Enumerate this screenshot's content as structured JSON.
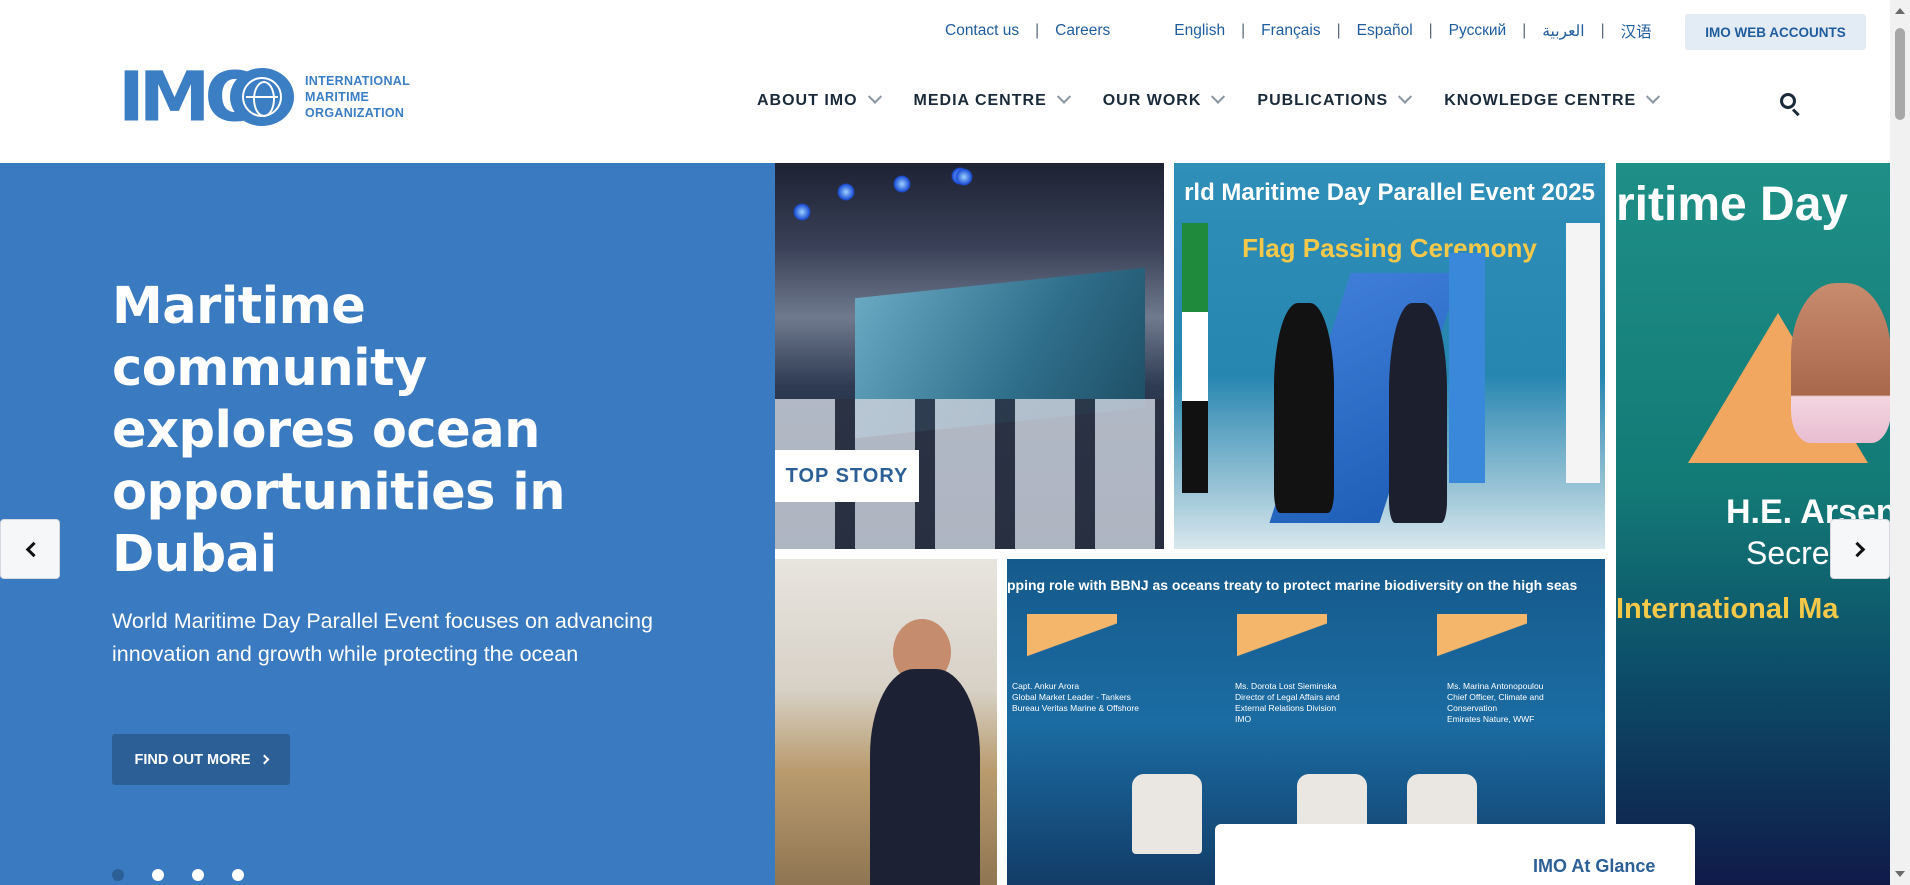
{
  "logo": {
    "word": "IMO",
    "lines": [
      "INTERNATIONAL",
      "MARITIME",
      "ORGANIZATION"
    ]
  },
  "utility_links": [
    "Contact us",
    "Careers"
  ],
  "languages": [
    "English",
    "Français",
    "Español",
    "Русский",
    "العربية",
    "汉语"
  ],
  "web_accounts_label": "IMO WEB ACCOUNTS",
  "nav": [
    {
      "label": "ABOUT IMO"
    },
    {
      "label": "MEDIA CENTRE"
    },
    {
      "label": "OUR WORK"
    },
    {
      "label": "PUBLICATIONS"
    },
    {
      "label": "KNOWLEDGE CENTRE"
    }
  ],
  "hero": {
    "title": "Maritime community explores ocean opportunities in Dubai",
    "subtitle": "World Maritime Day Parallel Event focuses on advancing innovation and growth while protecting the ocean",
    "cta_label": "FIND OUT MORE",
    "slide_count": 4,
    "active_slide": 1,
    "badge": "TOP STORY",
    "glance_label": "IMO At Glance"
  },
  "photos": {
    "p2_line1": "rld Maritime Day Parallel Event 2025",
    "p2_line2": "Flag Passing Ceremony",
    "p3_line1": "ritime Day",
    "p3_line2": "H.E. Arsen",
    "p3_line3": "Secret",
    "p3_line4": "International Ma",
    "p5_banner": "pping role with BBNJ as oceans treaty to protect marine biodiversity on the high seas",
    "p5_speakers": [
      {
        "name": "Capt. Ankur Arora",
        "role": "Global Market Leader - Tankers",
        "org": "Bureau Veritas Marine & Offshore"
      },
      {
        "name": "Ms. Dorota Lost Sieminska",
        "role": "Director of Legal Affairs and External Relations Division",
        "org": "IMO"
      },
      {
        "name": "Ms. Marina Antonopoulou",
        "role": "Chief Officer, Climate and Conservation",
        "org": "Emirates Nature, WWF"
      }
    ]
  },
  "colors": {
    "brand_blue": "#3b7ec4",
    "hero_blue": "#3a7ac0",
    "dark_blue": "#2c5f96",
    "nav_text": "#1b2a3a"
  },
  "icons": [
    "chevron-down-icon",
    "search-icon",
    "chevron-left-icon",
    "chevron-right-icon",
    "arrow-right-icon"
  ]
}
